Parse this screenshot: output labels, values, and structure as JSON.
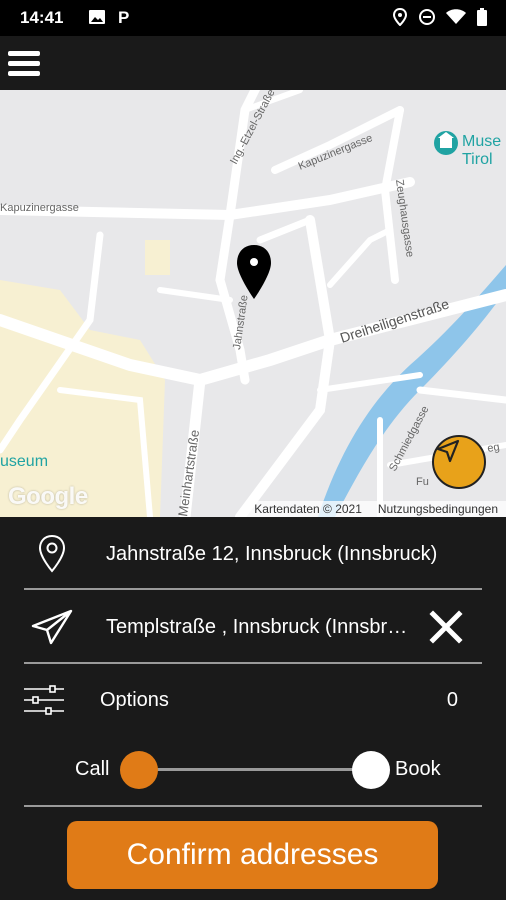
{
  "status_bar": {
    "time": "14:41",
    "left_icons": [
      "image-icon",
      "parking-icon"
    ],
    "right_icons": [
      "location-icon",
      "do-not-disturb-icon",
      "wifi-icon",
      "battery-icon"
    ]
  },
  "app_bar": {
    "menu_icon": "hamburger-menu-icon"
  },
  "map": {
    "streets": {
      "kapuzinergasse_top": "Kapuzinergasse",
      "kapuzinergasse_left": "Kapuzinergasse",
      "ing_etzel": "Ing.-Etzel-Straße",
      "zeughausgasse": "Zeughausgasse",
      "dreiheiligen": "Dreiheiligenstraße",
      "jahnstrasse": "Jahnstraße",
      "meinhart": "Meinhartstraße",
      "schmied": "Schmiedgasse",
      "fuge": "Fu",
      "weg": "eg"
    },
    "poi_top_right": "Muse\nTirol",
    "poi_left": "useum",
    "google_logo": "Google",
    "attribution": "Kartendaten © 2021",
    "terms": "Nutzungsbedingungen",
    "locate_icon": "navigation-arrow-icon",
    "pin_icon": "map-pin-icon",
    "accent_color": "#e8a21a"
  },
  "form": {
    "pickup": {
      "icon": "location-pin-outline-icon",
      "address": "Jahnstraße 12, Innsbruck (Innsbruck)"
    },
    "destination": {
      "icon": "send-arrow-icon",
      "address": "Templstraße , Innsbruck (Innsbruck)",
      "clear_icon": "close-icon"
    },
    "options": {
      "icon": "sliders-icon",
      "label": "Options",
      "count": "0"
    },
    "mode": {
      "left_label": "Call",
      "right_label": "Book"
    },
    "confirm_label": "Confirm addresses",
    "button_color": "#e07b17"
  }
}
